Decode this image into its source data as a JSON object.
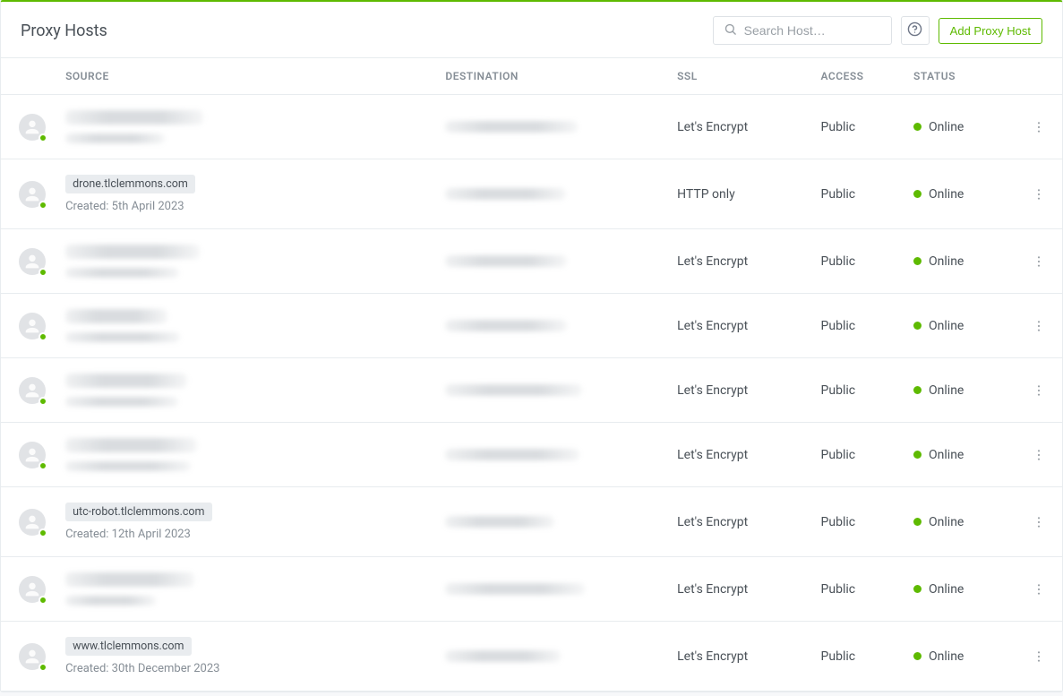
{
  "page": {
    "title": "Proxy Hosts"
  },
  "search": {
    "placeholder": "Search Host…"
  },
  "buttons": {
    "add": "Add Proxy Host"
  },
  "table": {
    "headers": {
      "source": "SOURCE",
      "destination": "DESTINATION",
      "ssl": "SSL",
      "access": "ACCESS",
      "status": "STATUS"
    },
    "rows": [
      {
        "source_blurred": true,
        "source_tag": "",
        "created": "",
        "created_blurred": true,
        "dest_blurred": true,
        "ssl": "Let's Encrypt",
        "access": "Public",
        "status": "Online",
        "status_color": "#5eba00"
      },
      {
        "source_blurred": false,
        "source_tag": "drone.tlclemmons.com",
        "created": "Created: 5th April 2023",
        "created_blurred": false,
        "dest_blurred": true,
        "ssl": "HTTP only",
        "access": "Public",
        "status": "Online",
        "status_color": "#5eba00"
      },
      {
        "source_blurred": true,
        "source_tag": "",
        "created": "",
        "created_blurred": true,
        "dest_blurred": true,
        "ssl": "Let's Encrypt",
        "access": "Public",
        "status": "Online",
        "status_color": "#5eba00"
      },
      {
        "source_blurred": true,
        "source_tag": "",
        "created": "",
        "created_blurred": true,
        "dest_blurred": true,
        "ssl": "Let's Encrypt",
        "access": "Public",
        "status": "Online",
        "status_color": "#5eba00"
      },
      {
        "source_blurred": true,
        "source_tag": "",
        "created": "",
        "created_blurred": true,
        "dest_blurred": true,
        "ssl": "Let's Encrypt",
        "access": "Public",
        "status": "Online",
        "status_color": "#5eba00"
      },
      {
        "source_blurred": true,
        "source_tag": "",
        "created": "",
        "created_blurred": true,
        "dest_blurred": true,
        "ssl": "Let's Encrypt",
        "access": "Public",
        "status": "Online",
        "status_color": "#5eba00"
      },
      {
        "source_blurred": false,
        "source_tag": "utc-robot.tlclemmons.com",
        "created": "Created: 12th April 2023",
        "created_blurred": false,
        "dest_blurred": true,
        "ssl": "Let's Encrypt",
        "access": "Public",
        "status": "Online",
        "status_color": "#5eba00"
      },
      {
        "source_blurred": true,
        "source_tag": "",
        "created": "",
        "created_blurred": true,
        "dest_blurred": true,
        "ssl": "Let's Encrypt",
        "access": "Public",
        "status": "Online",
        "status_color": "#5eba00"
      },
      {
        "source_blurred": false,
        "source_tag": "www.tlclemmons.com",
        "created": "Created: 30th December 2023",
        "created_blurred": false,
        "dest_blurred": true,
        "ssl": "Let's Encrypt",
        "access": "Public",
        "status": "Online",
        "status_color": "#5eba00"
      }
    ]
  }
}
